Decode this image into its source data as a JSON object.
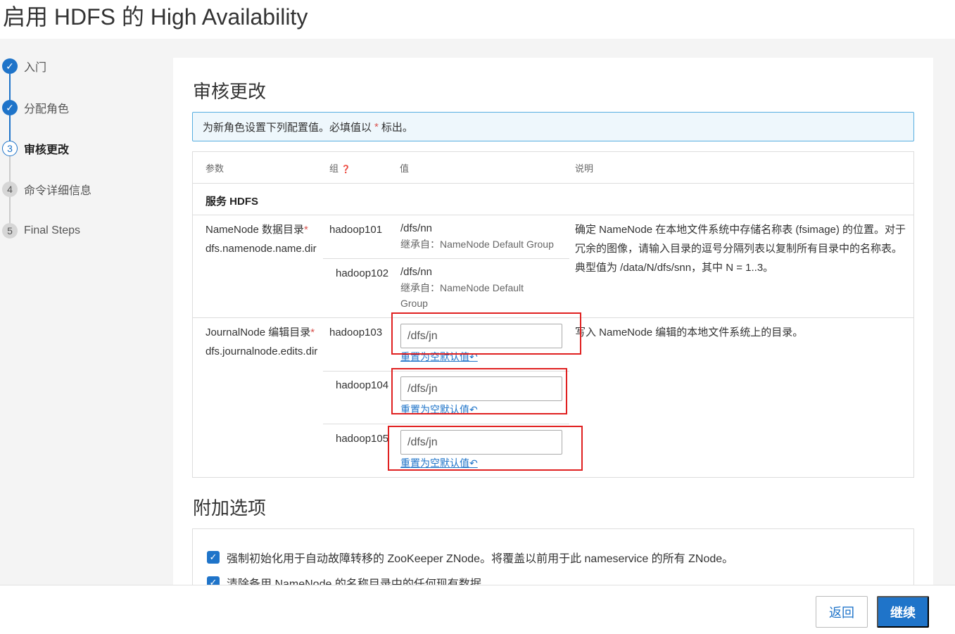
{
  "page_title": "启用 HDFS 的 High Availability",
  "steps": [
    {
      "num": "✓",
      "label": "入门",
      "state": "done"
    },
    {
      "num": "✓",
      "label": "分配角色",
      "state": "done"
    },
    {
      "num": "3",
      "label": "审核更改",
      "state": "current"
    },
    {
      "num": "4",
      "label": "命令详细信息",
      "state": "todo"
    },
    {
      "num": "5",
      "label": "Final Steps",
      "state": "todo"
    }
  ],
  "review": {
    "title": "审核更改",
    "info_prefix": "为新角色设置下列配置值。必填值以",
    "info_star": "*",
    "info_suffix": "标出。",
    "headers": {
      "param": "参数",
      "group": "组",
      "group_icon": "❓",
      "value": "值",
      "desc": "说明"
    },
    "service_label": "服务 HDFS",
    "namenode": {
      "label": "NameNode 数据目录",
      "star": "*",
      "key": "dfs.namenode.name.dir",
      "hosts": [
        {
          "host": "hadoop101",
          "value": "/dfs/nn",
          "inherit_line1": "继承自：NameNode Default Group",
          "inherit_line2": ""
        },
        {
          "host": "hadoop102",
          "value": "/dfs/nn",
          "inherit_line1": "继承自：NameNode Default",
          "inherit_line2": "Group"
        }
      ],
      "desc_line1": "确定 NameNode 在本地文件系统中存储名称表 (fsimage) 的位置。对于",
      "desc_line2": "冗余的图像，请输入目录的逗号分隔列表以复制所有目录中的名称表。",
      "desc_line3": "典型值为 /data/N/dfs/snn，其中 N = 1..3。"
    },
    "journalnode": {
      "label": "JournalNode 编辑目录",
      "star": "*",
      "key": "dfs.journalnode.edits.dir",
      "hosts": [
        {
          "host": "hadoop103",
          "value": "/dfs/jn",
          "reset": "重置为空默认值"
        },
        {
          "host": "hadoop104",
          "value": "/dfs/jn",
          "reset": "重置为空默认值"
        },
        {
          "host": "hadoop105",
          "value": "/dfs/jn",
          "reset": "重置为空默认值"
        }
      ],
      "desc": "写入 NameNode 编辑的本地文件系统上的目录。"
    }
  },
  "options": {
    "title": "附加选项",
    "items": [
      "强制初始化用于自动故障转移的 ZooKeeper ZNode。将覆盖以前用于此 nameservice 的所有 ZNode。",
      "清除备用 NameNode 的名称目录中的任何现有数据。"
    ]
  },
  "footer": {
    "back": "返回",
    "next": "继续"
  },
  "colors": {
    "accent": "#1f74c9",
    "highlight_box": "#e02020"
  }
}
